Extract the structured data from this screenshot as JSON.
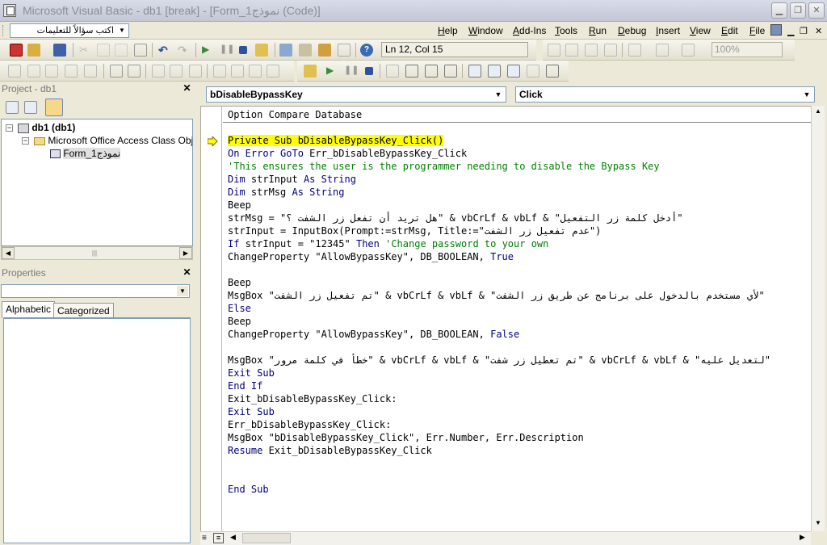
{
  "window": {
    "title": "Microsoft Visual Basic - db1 [break] - [Form_نموذج1 (Code)]"
  },
  "menubar": {
    "ask_placeholder": "اكتب سؤالاً للتعليمات",
    "items": [
      {
        "label": "Help",
        "key": "H",
        "rest": "elp"
      },
      {
        "label": "Window",
        "key": "W",
        "rest": "indow"
      },
      {
        "label": "Add-Ins",
        "key": "A",
        "rest": "dd-Ins"
      },
      {
        "label": "Tools",
        "key": "T",
        "rest": "ools"
      },
      {
        "label": "Run",
        "key": "R",
        "rest": "un"
      },
      {
        "label": "Debug",
        "key": "D",
        "rest": "ebug"
      },
      {
        "label": "Insert",
        "key": "I",
        "rest": "nsert"
      },
      {
        "label": "View",
        "key": "V",
        "rest": "iew"
      },
      {
        "label": "Edit",
        "key": "E",
        "rest": "dit"
      },
      {
        "label": "File",
        "key": "F",
        "rest": "ile"
      }
    ]
  },
  "toolbar": {
    "position": "Ln 12, Col 15",
    "zoom": "100%"
  },
  "project": {
    "title": "Project - db1",
    "tree": [
      {
        "label": "db1 (db1)"
      },
      {
        "label": "Microsoft Office Access Class Objects"
      },
      {
        "label": "Form_نموذج1"
      }
    ]
  },
  "properties": {
    "title": "Properties",
    "tabs": [
      {
        "label": "Alphabetic"
      },
      {
        "label": "Categorized"
      }
    ]
  },
  "code": {
    "object": "bDisableBypassKey",
    "procedure": "Click",
    "declarations": "Option Compare Database",
    "lines": [
      [
        {
          "t": "Private Sub bDisableBypassKey_Click()",
          "c": "hl"
        }
      ],
      [
        {
          "t": "On Error GoTo ",
          "c": "kw"
        },
        {
          "t": "Err_bDisableBypassKey_Click"
        }
      ],
      [
        {
          "t": "'This ensures the user is the programmer needing to disable the Bypass Key",
          "c": "cm"
        }
      ],
      [
        {
          "t": "Dim ",
          "c": "kw"
        },
        {
          "t": "strInput "
        },
        {
          "t": "As String",
          "c": "kw"
        }
      ],
      [
        {
          "t": "Dim ",
          "c": "kw"
        },
        {
          "t": "strMsg "
        },
        {
          "t": "As String",
          "c": "kw"
        }
      ],
      [
        {
          "t": "Beep"
        }
      ],
      [
        {
          "t": "strMsg = \"هل تريد أن تفعل زر الشفت ؟\" & vbCrLf & vbLf & \"أدخل كلمة زر التفعيل\""
        }
      ],
      [
        {
          "t": "strInput = InputBox(Prompt:=strMsg, Title:=\"عدم تفعيل زر الشفت\")"
        }
      ],
      [
        {
          "t": "If ",
          "c": "kw"
        },
        {
          "t": "strInput = \"12345\" "
        },
        {
          "t": "Then ",
          "c": "kw"
        },
        {
          "t": "'Change password to your own",
          "c": "cm"
        }
      ],
      [
        {
          "t": "ChangeProperty \"AllowBypassKey\", DB_BOOLEAN, "
        },
        {
          "t": "True",
          "c": "kw"
        }
      ],
      [
        {
          "t": ""
        }
      ],
      [
        {
          "t": "Beep"
        }
      ],
      [
        {
          "t": "MsgBox \"تم تفعيل زر الشفت\" & vbCrLf & vbLf & \"لأي مستخدم بالدخول على برنامج عن طريق زر الشفت\""
        }
      ],
      [
        {
          "t": "Else",
          "c": "kw"
        }
      ],
      [
        {
          "t": "Beep"
        }
      ],
      [
        {
          "t": "ChangeProperty \"AllowBypassKey\", DB_BOOLEAN, "
        },
        {
          "t": "False",
          "c": "kw"
        }
      ],
      [
        {
          "t": ""
        }
      ],
      [
        {
          "t": "MsgBox \"خطأ في كلمة مرور\" & vbCrLf & vbLf & \"تم تعطيل زر شفت\" & vbCrLf & vbLf & \"لتعديل عليه\""
        }
      ],
      [
        {
          "t": "Exit Sub",
          "c": "kw"
        }
      ],
      [
        {
          "t": "End If",
          "c": "kw"
        }
      ],
      [
        {
          "t": "Exit_bDisableBypassKey_Click:"
        }
      ],
      [
        {
          "t": "Exit Sub",
          "c": "kw"
        }
      ],
      [
        {
          "t": "Err_bDisableBypassKey_Click:"
        }
      ],
      [
        {
          "t": "MsgBox \"bDisableBypassKey_Click\", Err.Number, Err.Description"
        }
      ],
      [
        {
          "t": "Resume ",
          "c": "kw"
        },
        {
          "t": "Exit_bDisableBypassKey_Click"
        }
      ],
      [
        {
          "t": ""
        }
      ],
      [
        {
          "t": ""
        }
      ],
      [
        {
          "t": "End Sub",
          "c": "kw"
        }
      ]
    ]
  },
  "colors": {
    "keyword": "#00007f",
    "comment": "#007f00",
    "highlight": "#ffff00",
    "title_text": "#8a8c95"
  }
}
